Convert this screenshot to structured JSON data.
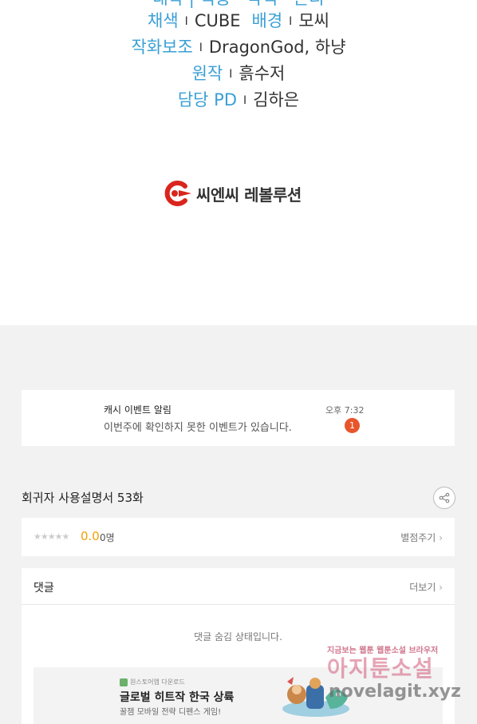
{
  "credits": {
    "partial_top_line": "대작 | 적용 · 각색 · 콘티",
    "lines": [
      {
        "role": "채색",
        "value": "CUBE",
        "role2": "배경",
        "value2": "모씨"
      },
      {
        "role": "작화보조",
        "value": "DragonGod, 하냥"
      },
      {
        "role": "원작",
        "value": "흙수저"
      },
      {
        "role": "담당 PD",
        "value": "김하은"
      }
    ],
    "separator": "I",
    "publisher": "씨엔씨 레볼루션"
  },
  "notification": {
    "title": "캐시 이벤트 알림",
    "message": "이번주에 확인하지 못한 이벤트가 있습니다.",
    "time": "오후 7:32",
    "badge_count": "1",
    "badge_color": "#e8552c"
  },
  "episode": {
    "title": "회귀자 사용설명서 53화",
    "share_icon": "share-icon"
  },
  "rating": {
    "stars": "★★★★★",
    "score": "0.0",
    "count": "0명",
    "rate_label": "별점주기",
    "score_color": "#f2a000"
  },
  "comments": {
    "title": "댓글",
    "more_label": "더보기",
    "hidden_message": "댓글 숨김 상태입니다."
  },
  "ad": {
    "source": "원스토어앱 다운로드",
    "title": "글로벌 히트작 한국 상륙",
    "subtitle": "꿀잼 모바일 전략 디펜스 게임!"
  },
  "watermark": {
    "tagline": "지금보는 웹툰 웹툰소설 브라우저",
    "brand": "아지툰소설",
    "url": "novelagit.xyz"
  },
  "colors": {
    "accent_blue": "#3aa0d6",
    "logo_red": "#d9251d"
  }
}
